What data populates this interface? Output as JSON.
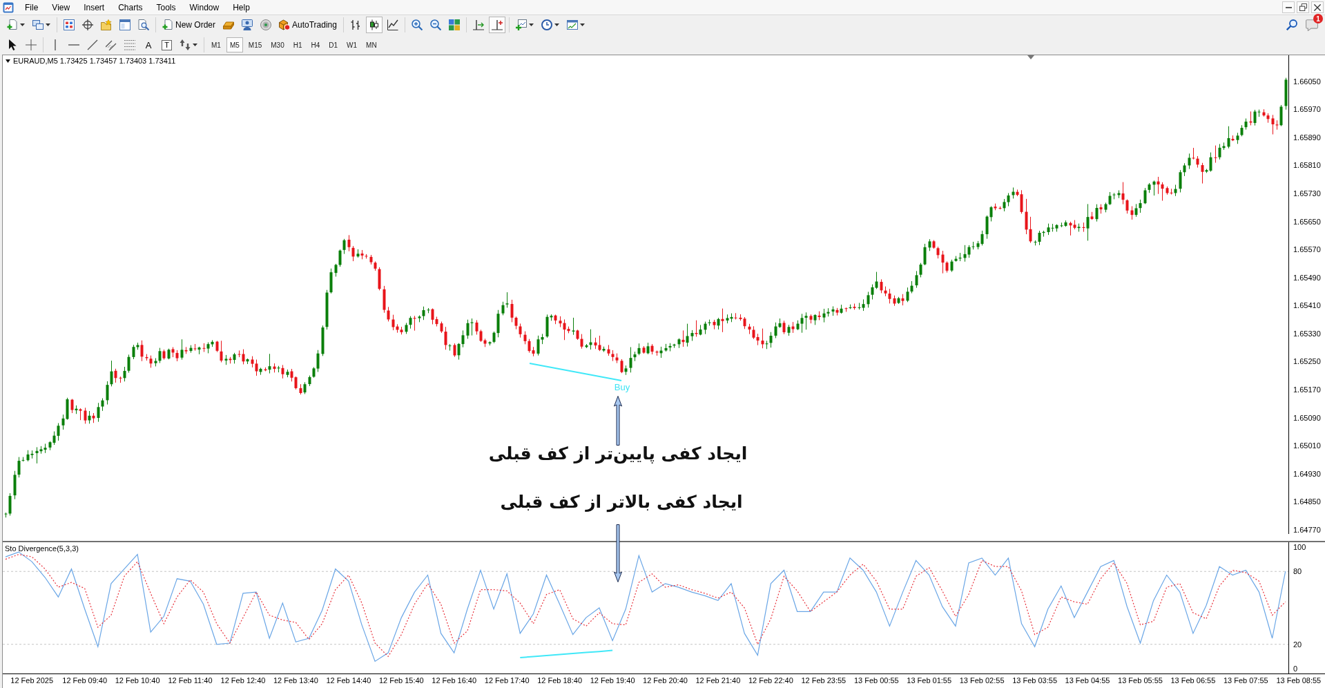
{
  "menu_bar": {
    "items": [
      "File",
      "View",
      "Insert",
      "Charts",
      "Tools",
      "Window",
      "Help"
    ]
  },
  "toolbar": {
    "new_order": "New Order",
    "autotrading": "AutoTrading",
    "chart_types": [
      {
        "selected": false
      },
      {
        "selected": true
      },
      {
        "selected": false
      }
    ],
    "auto_scroll": {
      "on": false
    },
    "chart_shift": {
      "on": true
    },
    "notification_count": "1"
  },
  "drawing_tools": {
    "text": "A",
    "text_label": "T"
  },
  "timeframes": [
    {
      "label": "M1",
      "selected": false
    },
    {
      "label": "M5",
      "selected": true
    },
    {
      "label": "M15",
      "selected": false
    },
    {
      "label": "M30",
      "selected": false
    },
    {
      "label": "H1",
      "selected": false
    },
    {
      "label": "H4",
      "selected": false
    },
    {
      "label": "D1",
      "selected": false
    },
    {
      "label": "W1",
      "selected": false
    },
    {
      "label": "MN",
      "selected": false
    }
  ],
  "chart": {
    "title": "EURAUD,M5 1.73425 1.73457 1.73403 1.73411",
    "price_axis": [
      "1.66050",
      "1.65970",
      "1.65890",
      "1.65810",
      "1.65730",
      "1.65650",
      "1.65570",
      "1.65490",
      "1.65410",
      "1.65330",
      "1.65250",
      "1.65170",
      "1.65090",
      "1.65010",
      "1.64930",
      "1.64850",
      "1.64770"
    ],
    "signal_label": "Buy",
    "annotations": [
      "ایجاد کفی پایین‌تر از کف قبلی",
      "ایجاد کفی بالاتر از کف قبلی"
    ]
  },
  "indicator": {
    "title": "Sto Divergence(5,3,3)",
    "chart_data": {
      "type": "line",
      "categories": [
        null,
        null,
        "12 Feb 2025",
        null,
        null,
        null,
        "12 Feb 09:40",
        null,
        null,
        null,
        "12 Feb 10:40",
        null,
        null,
        null,
        "12 Feb 11:40",
        null,
        null,
        null,
        "12 Feb 12:40",
        null,
        null,
        null,
        "12 Feb 13:40",
        null,
        null,
        null,
        "12 Feb 14:40",
        null,
        null,
        null,
        "12 Feb 15:40",
        null,
        null,
        null,
        "12 Feb 16:40",
        null,
        null,
        null,
        "12 Feb 17:40",
        null,
        null,
        null,
        "12 Feb 18:40",
        null,
        null,
        null,
        "12 Feb 19:40",
        null,
        null,
        null,
        "12 Feb 20:40",
        null,
        null,
        null,
        "12 Feb 21:40",
        null,
        null,
        null,
        "12 Feb 22:40",
        null,
        null,
        null,
        "12 Feb 23:55",
        null,
        null,
        null,
        "13 Feb 00:55",
        null,
        null,
        null,
        "13 Feb 01:55",
        null,
        null,
        null,
        "13 Feb 02:55",
        null,
        null,
        null,
        "13 Feb 03:55",
        null,
        null,
        null,
        "13 Feb 04:55",
        null,
        null,
        null,
        "13 Feb 05:55",
        null,
        null,
        null,
        "13 Feb 06:55",
        null,
        null,
        null,
        "13 Feb 07:55",
        null,
        null,
        null,
        "13 Feb 08:55"
      ],
      "series": [
        {
          "color": "#6aa6e6",
          "values": [
            92,
            96,
            88,
            75,
            59,
            82,
            49,
            18,
            70,
            82,
            94,
            30,
            43,
            74,
            72,
            53,
            20,
            21,
            62,
            63,
            25,
            54,
            22,
            25,
            48,
            82,
            72,
            36,
            6,
            13,
            42,
            63,
            77,
            29,
            13,
            49,
            81,
            49,
            78,
            29,
            45,
            77,
            53,
            28,
            42,
            50,
            23,
            49,
            93,
            63,
            70,
            67,
            63,
            60,
            56,
            70,
            29,
            11,
            70,
            81,
            47,
            47,
            63,
            63,
            91,
            81,
            63,
            35,
            63,
            89,
            77,
            51,
            35,
            87,
            91,
            77,
            91,
            37,
            18,
            49,
            68,
            42,
            63,
            84,
            89,
            51,
            21,
            56,
            77,
            63,
            29,
            52,
            84,
            77,
            81,
            63,
            25,
            80,
            null
          ]
        },
        {
          "color": "#e8303a",
          "line_style": "dotted",
          "values": [
            90,
            94,
            92,
            82,
            67,
            71,
            66,
            34,
            44,
            76,
            88,
            62,
            37,
            59,
            73,
            63,
            37,
            21,
            42,
            63,
            44,
            40,
            38,
            24,
            37,
            65,
            77,
            54,
            21,
            10,
            28,
            53,
            70,
            53,
            21,
            31,
            65,
            65,
            64,
            54,
            37,
            61,
            65,
            41,
            35,
            46,
            37,
            36,
            71,
            78,
            67,
            69,
            65,
            62,
            58,
            63,
            50,
            20,
            41,
            76,
            64,
            47,
            55,
            63,
            77,
            86,
            72,
            49,
            49,
            76,
            83,
            64,
            43,
            61,
            89,
            84,
            84,
            64,
            28,
            34,
            59,
            55,
            53,
            74,
            87,
            70,
            36,
            39,
            67,
            70,
            46,
            41,
            68,
            81,
            79,
            72,
            44,
            55,
            null
          ]
        },
        {
          "color": "#40e8f8",
          "values": [
            null,
            null,
            null,
            null,
            null,
            null,
            null,
            null,
            null,
            null,
            null,
            null,
            null,
            null,
            null,
            null,
            null,
            null,
            null,
            null,
            null,
            null,
            null,
            null,
            null,
            null,
            null,
            null,
            null,
            null,
            null,
            null,
            null,
            null,
            null,
            null,
            null,
            null,
            null,
            9,
            9.9,
            10.7,
            11.6,
            12.4,
            13.3,
            14.1,
            15,
            null,
            null,
            null,
            null,
            null,
            null,
            null,
            null,
            null,
            null,
            null,
            null,
            null,
            null,
            null,
            null,
            null,
            null,
            null,
            null,
            null,
            null,
            null,
            null,
            null,
            null,
            null,
            null,
            null,
            null,
            null,
            null,
            null,
            null,
            null,
            null,
            null,
            null,
            null,
            null,
            null,
            null,
            null,
            null,
            null,
            null,
            null,
            null,
            null,
            null,
            null,
            null
          ]
        }
      ],
      "ylim": [
        -4,
        104
      ],
      "yticks": [
        0,
        20,
        80,
        100
      ]
    }
  }
}
